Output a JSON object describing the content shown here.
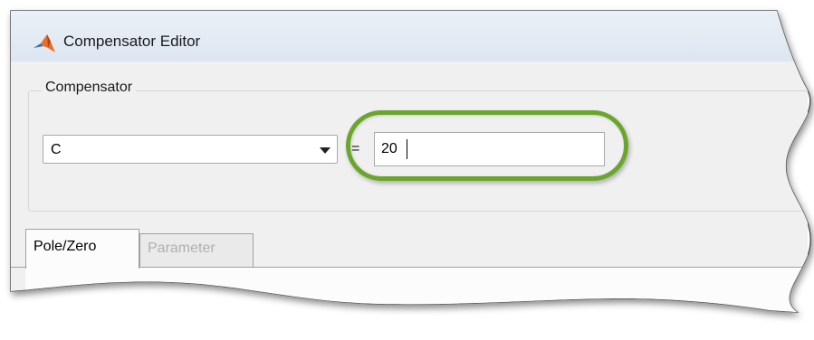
{
  "window": {
    "title": "Compensator Editor",
    "app_icon": "matlab-logo-icon"
  },
  "compensator_group": {
    "label": "Compensator",
    "selector": {
      "value": "C",
      "arrow_icon": "dropdown-arrow-icon"
    },
    "equals_label": "=",
    "value_input": {
      "value": "20"
    },
    "highlight_color": "#6aa62c"
  },
  "tabs": [
    {
      "label": "Pole/Zero",
      "active": true
    },
    {
      "label": "Parameter",
      "active": false
    }
  ]
}
